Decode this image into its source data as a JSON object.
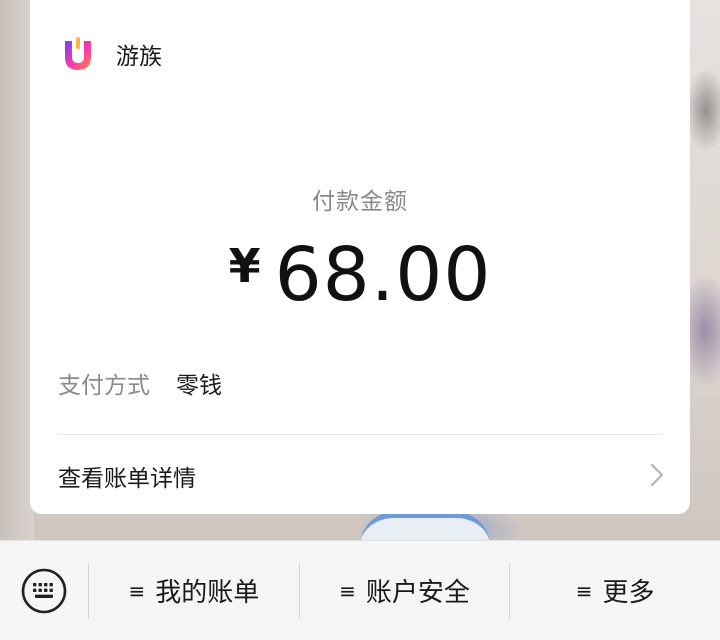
{
  "merchant": {
    "name": "游族",
    "logo_icon": "youzu-logo-icon",
    "logo_colors": [
      "#7b3df2",
      "#ff3aa8",
      "#ffb640"
    ]
  },
  "payment": {
    "amount_label": "付款金额",
    "currency_symbol": "¥",
    "amount": "68.00",
    "method_label": "支付方式",
    "method_value": "零钱",
    "bill_details_label": "查看账单详情",
    "bill_details_icon": "chevron-right-icon"
  },
  "bottom_menu": {
    "keyboard_icon": "keyboard-icon",
    "menu_icon": "≡",
    "items": [
      {
        "label": "我的账单"
      },
      {
        "label": "账户安全"
      },
      {
        "label": "更多"
      }
    ]
  }
}
